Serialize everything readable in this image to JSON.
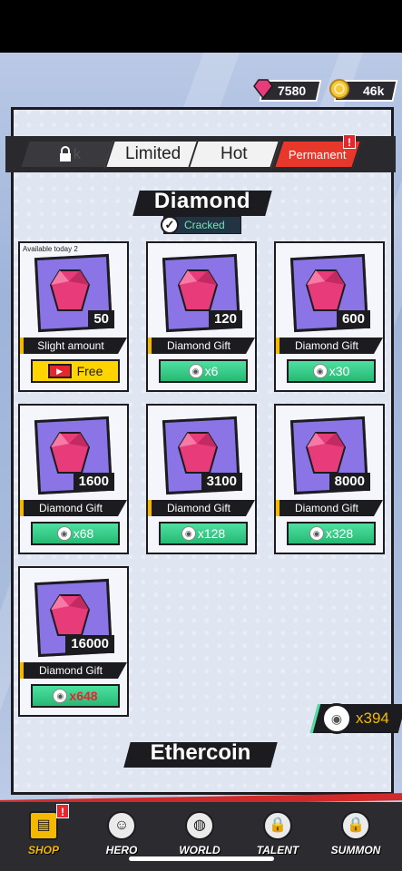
{
  "currency": {
    "diamond": "7580",
    "gold": "46k"
  },
  "tabs": [
    {
      "label": "k",
      "state": "locked"
    },
    {
      "label": "Limited",
      "state": "normal"
    },
    {
      "label": "Hot",
      "state": "normal"
    },
    {
      "label": "Permanent",
      "state": "active",
      "badge": "!"
    }
  ],
  "section": {
    "title": "Diamond",
    "status": "Cracked"
  },
  "items": [
    {
      "avail": "Available today  2",
      "amount": "50",
      "name": "Slight amount",
      "price": "Free",
      "price_type": "ad"
    },
    {
      "amount": "120",
      "name": "Diamond Gift",
      "price": "x6",
      "price_type": "orb"
    },
    {
      "amount": "600",
      "name": "Diamond Gift",
      "price": "x30",
      "price_type": "orb"
    },
    {
      "amount": "1600",
      "name": "Diamond Gift",
      "price": "x68",
      "price_type": "orb"
    },
    {
      "amount": "3100",
      "name": "Diamond Gift",
      "price": "x128",
      "price_type": "orb"
    },
    {
      "amount": "8000",
      "name": "Diamond Gift",
      "price": "x328",
      "price_type": "orb"
    },
    {
      "amount": "16000",
      "name": "Diamond Gift",
      "price": "x648",
      "price_type": "orb-red"
    }
  ],
  "orb_balance": "x394",
  "next_section": "Ethercoin",
  "nav": [
    {
      "label": "SHOP",
      "icon": "shop-icon",
      "active": true,
      "badge": "!"
    },
    {
      "label": "HERO",
      "icon": "hero-icon"
    },
    {
      "label": "WORLD",
      "icon": "world-icon"
    },
    {
      "label": "TALENT",
      "icon": "talent-lock-icon"
    },
    {
      "label": "SUMMON",
      "icon": "summon-lock-icon"
    }
  ],
  "colors": {
    "accent_red": "#e8382c",
    "price_green": "#27b874",
    "gold": "#f5b800",
    "tile_art": "#8a74e6",
    "gem": "#e83c7a"
  }
}
